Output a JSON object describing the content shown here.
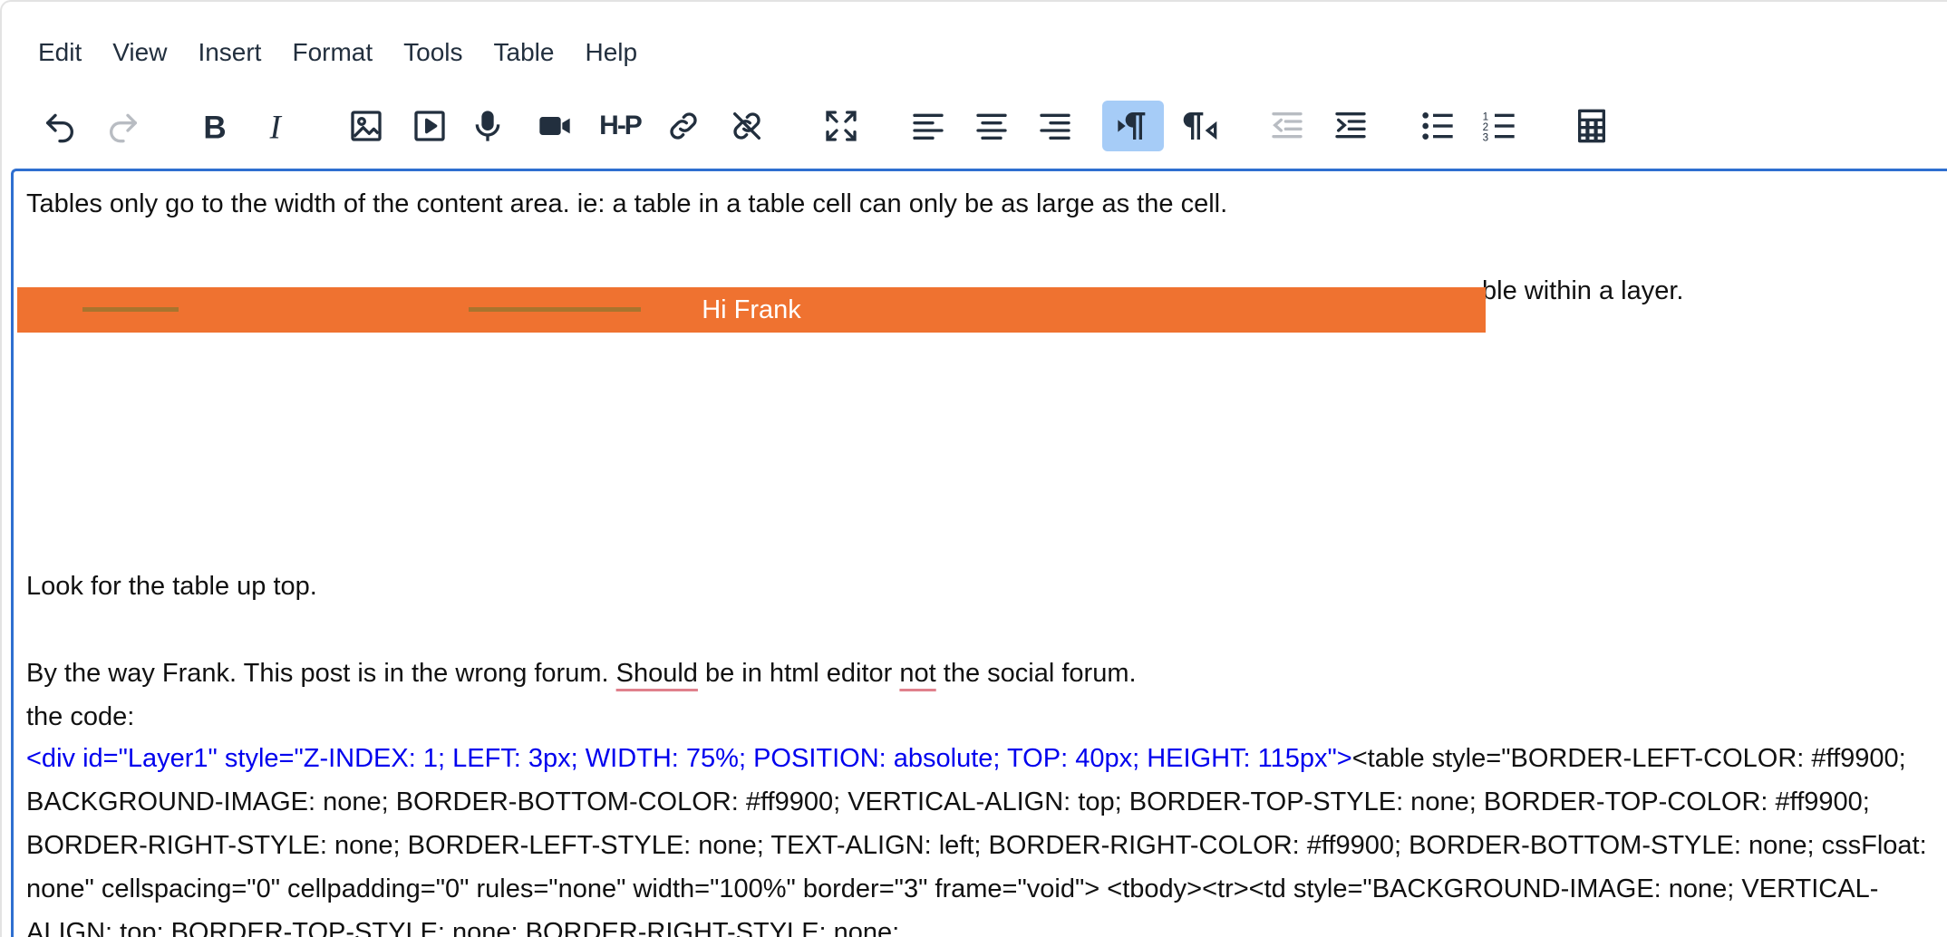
{
  "menubar": {
    "items": [
      "Edit",
      "View",
      "Insert",
      "Format",
      "Tools",
      "Table",
      "Help"
    ]
  },
  "toolbar": {
    "buttons": [
      {
        "icon": "undo-icon",
        "state": "enabled"
      },
      {
        "icon": "redo-icon",
        "state": "disabled"
      },
      {
        "icon": "bold-icon",
        "state": "enabled"
      },
      {
        "icon": "italic-icon",
        "state": "enabled"
      },
      {
        "icon": "image-icon",
        "state": "enabled"
      },
      {
        "icon": "media-icon",
        "state": "enabled"
      },
      {
        "icon": "microphone-icon",
        "state": "enabled"
      },
      {
        "icon": "video-camera-icon",
        "state": "enabled"
      },
      {
        "icon": "h5p-icon",
        "state": "enabled"
      },
      {
        "icon": "link-icon",
        "state": "enabled"
      },
      {
        "icon": "unlink-icon",
        "state": "enabled"
      },
      {
        "icon": "fullscreen-icon",
        "state": "enabled"
      },
      {
        "icon": "align-left-icon",
        "state": "enabled"
      },
      {
        "icon": "align-center-icon",
        "state": "enabled"
      },
      {
        "icon": "align-right-icon",
        "state": "enabled"
      },
      {
        "icon": "ltr-icon",
        "state": "active"
      },
      {
        "icon": "rtl-icon",
        "state": "enabled"
      },
      {
        "icon": "outdent-icon",
        "state": "disabled"
      },
      {
        "icon": "indent-icon",
        "state": "enabled"
      },
      {
        "icon": "bullet-list-icon",
        "state": "enabled"
      },
      {
        "icon": "numbered-list-icon",
        "state": "enabled"
      },
      {
        "icon": "calculator-icon",
        "state": "enabled"
      }
    ],
    "h5p_label": "H-P"
  },
  "content": {
    "para1": "Tables only go to the width of the content area. ie: a table in a table cell can only be as large as the cell.",
    "para2_visible": "ble within a layer.",
    "layer_text": "Hi Frank",
    "para3": "Look for the table up top.",
    "para4_a": "By the way Frank.  This post is in the wrong forum.  ",
    "para4_should": "Should",
    "para4_b": " be in html editor ",
    "para4_not": "not",
    "para4_c": " the social forum.",
    "para5": "the code:",
    "code_blue": "<div id=\"Layer1\" style=\"Z-INDEX: 1; LEFT: 3px; WIDTH: 75%; POSITION: absolute; TOP: 40px; HEIGHT: 115px\">",
    "code_black": "<table style=\"BORDER-LEFT-COLOR: #ff9900; BACKGROUND-IMAGE: none; BORDER-BOTTOM-COLOR: #ff9900; VERTICAL-ALIGN: top; BORDER-TOP-STYLE: none; BORDER-TOP-COLOR: #ff9900; BORDER-RIGHT-STYLE: none; BORDER-LEFT-STYLE: none; TEXT-ALIGN: left; BORDER-RIGHT-COLOR: #ff9900; BORDER-BOTTOM-STYLE: none; cssFloat: none\" cellspacing=\"0\" cellpadding=\"0\" rules=\"none\" width=\"100%\" border=\"3\" frame=\"void\"> <tbody><tr><td style=\"BACKGROUND-IMAGE: none; VERTICAL-ALIGN: top; BORDER-TOP-STYLE: none; BORDER-RIGHT-STYLE: none;"
  },
  "colors": {
    "layer_bg": "#ef7230",
    "active_button": "#a6ccf7",
    "focus_border": "#2f6fd0",
    "code_blue": "#0000ee"
  }
}
